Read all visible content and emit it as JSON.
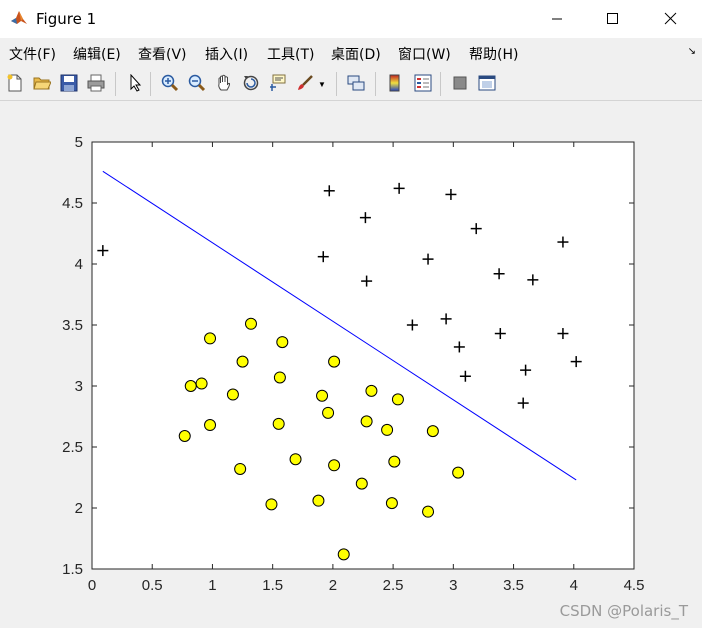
{
  "window": {
    "title": "Figure 1",
    "minimize_icon": "minimize-icon",
    "maximize_icon": "maximize-icon",
    "close_icon": "close-icon"
  },
  "menu": [
    {
      "label": "文件(F)"
    },
    {
      "label": "编辑(E)"
    },
    {
      "label": "查看(V)"
    },
    {
      "label": "插入(I)"
    },
    {
      "label": "工具(T)"
    },
    {
      "label": "桌面(D)"
    },
    {
      "label": "窗口(W)"
    },
    {
      "label": "帮助(H)"
    }
  ],
  "toolbar": {
    "icons": [
      "new-figure-icon",
      "open-icon",
      "save-icon",
      "print-icon",
      "select-arrow-icon",
      "zoom-in-icon",
      "zoom-out-icon",
      "pan-hand-icon",
      "rotate-3d-icon",
      "data-cursor-icon",
      "brush-icon",
      "link-plot-icon",
      "colorbar-icon",
      "legend-icon",
      "hide-plot-tools-icon",
      "show-plot-tools-icon"
    ]
  },
  "watermark": "CSDN @Polaris_T",
  "chart_data": {
    "type": "scatter",
    "title": "",
    "xlabel": "",
    "ylabel": "",
    "xlim": [
      0,
      4.5
    ],
    "ylim": [
      1.5,
      5
    ],
    "xticks": [
      "0",
      "0.5",
      "1",
      "1.5",
      "2",
      "2.5",
      "3",
      "3.5",
      "4",
      "4.5"
    ],
    "yticks": [
      "1.5",
      "2",
      "2.5",
      "3",
      "3.5",
      "4",
      "4.5",
      "5"
    ],
    "grid": false,
    "series": [
      {
        "marker": "plus",
        "color": "#000000",
        "points": [
          [
            0.09,
            4.11
          ],
          [
            1.97,
            4.6
          ],
          [
            2.27,
            4.38
          ],
          [
            2.55,
            4.62
          ],
          [
            2.98,
            4.57
          ],
          [
            3.19,
            4.29
          ],
          [
            3.91,
            4.18
          ],
          [
            1.92,
            4.06
          ],
          [
            2.28,
            3.86
          ],
          [
            2.79,
            4.04
          ],
          [
            3.38,
            3.92
          ],
          [
            3.66,
            3.87
          ],
          [
            2.66,
            3.5
          ],
          [
            2.94,
            3.55
          ],
          [
            3.39,
            3.43
          ],
          [
            3.91,
            3.43
          ],
          [
            4.02,
            3.2
          ],
          [
            3.05,
            3.32
          ],
          [
            3.1,
            3.08
          ],
          [
            3.6,
            3.13
          ],
          [
            3.58,
            2.86
          ]
        ]
      },
      {
        "marker": "circle",
        "color": "#ffff00",
        "points": [
          [
            0.77,
            2.59
          ],
          [
            0.82,
            3.0
          ],
          [
            0.91,
            3.02
          ],
          [
            0.98,
            3.39
          ],
          [
            0.98,
            2.68
          ],
          [
            1.17,
            2.93
          ],
          [
            1.23,
            2.32
          ],
          [
            1.25,
            3.2
          ],
          [
            1.32,
            3.51
          ],
          [
            1.49,
            2.03
          ],
          [
            1.55,
            2.69
          ],
          [
            1.56,
            3.07
          ],
          [
            1.58,
            3.36
          ],
          [
            1.69,
            2.4
          ],
          [
            1.88,
            2.06
          ],
          [
            1.91,
            2.92
          ],
          [
            1.96,
            2.78
          ],
          [
            2.01,
            3.2
          ],
          [
            2.01,
            2.35
          ],
          [
            2.09,
            1.62
          ],
          [
            2.24,
            2.2
          ],
          [
            2.28,
            2.71
          ],
          [
            2.32,
            2.96
          ],
          [
            2.45,
            2.64
          ],
          [
            2.49,
            2.04
          ],
          [
            2.51,
            2.38
          ],
          [
            2.54,
            2.89
          ],
          [
            2.79,
            1.97
          ],
          [
            2.83,
            2.63
          ],
          [
            3.04,
            2.29
          ]
        ]
      }
    ],
    "decision_boundary": {
      "color": "#0000ff",
      "points": [
        [
          0.09,
          4.76
        ],
        [
          4.02,
          2.23
        ]
      ]
    }
  }
}
